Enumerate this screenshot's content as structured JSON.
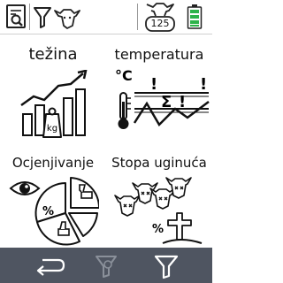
{
  "top_bar": {
    "cow_count": "125"
  },
  "tiles": [
    {
      "id": "tezina",
      "label": "težina",
      "icon": "weight-growth-icon"
    },
    {
      "id": "temperatura",
      "label": "temperatura",
      "icon": "temperature-chart-icon",
      "icon_text": {
        "unit": "°C",
        "sigma": "Σ",
        "bang": "!"
      }
    },
    {
      "id": "ocjenjivanje",
      "label": "Ocjenjivanje",
      "icon": "assessment-pie-icon",
      "icon_text": {
        "percent": "%"
      }
    },
    {
      "id": "stopa",
      "label": "Stopa uginuća",
      "icon": "mortality-icon",
      "icon_text": {
        "percent": "%"
      }
    }
  ],
  "bottom_bar": {
    "background": "#4f5561"
  },
  "colors": {
    "battery": "#2db34a",
    "chart_accent": "#111111"
  }
}
